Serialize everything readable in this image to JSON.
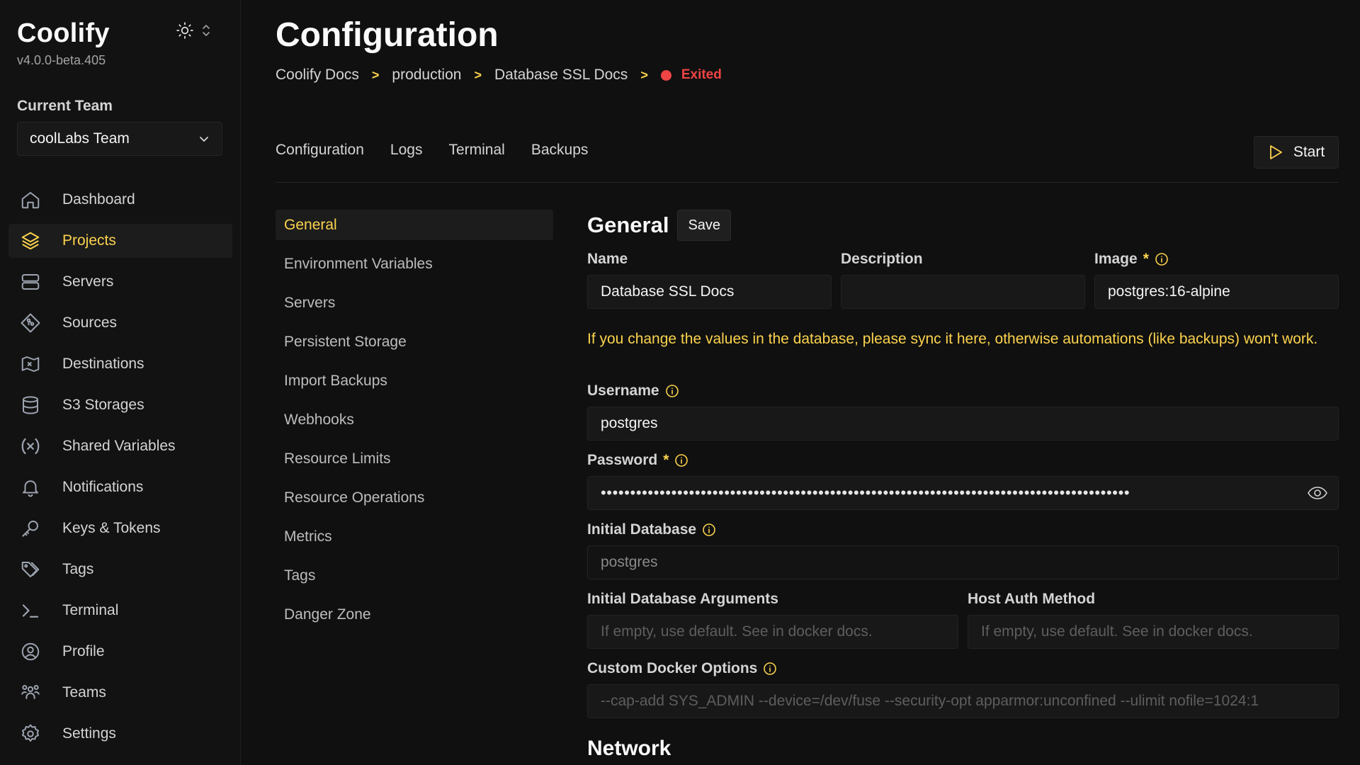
{
  "app": {
    "name": "Coolify",
    "version": "v4.0.0-beta.405"
  },
  "team": {
    "label": "Current Team",
    "selected": "coolLabs Team"
  },
  "sidebar": {
    "items": [
      {
        "label": "Dashboard",
        "icon": "home-icon"
      },
      {
        "label": "Projects",
        "icon": "layers-icon",
        "active": true
      },
      {
        "label": "Servers",
        "icon": "server-icon"
      },
      {
        "label": "Sources",
        "icon": "git-icon"
      },
      {
        "label": "Destinations",
        "icon": "destination-icon"
      },
      {
        "label": "S3 Storages",
        "icon": "database-icon"
      },
      {
        "label": "Shared Variables",
        "icon": "variable-icon"
      },
      {
        "label": "Notifications",
        "icon": "bell-icon"
      },
      {
        "label": "Keys & Tokens",
        "icon": "key-icon"
      },
      {
        "label": "Tags",
        "icon": "tag-icon"
      },
      {
        "label": "Terminal",
        "icon": "terminal-icon"
      },
      {
        "label": "Profile",
        "icon": "user-circle-icon"
      },
      {
        "label": "Teams",
        "icon": "users-icon"
      },
      {
        "label": "Settings",
        "icon": "gear-icon"
      }
    ]
  },
  "page": {
    "title": "Configuration",
    "breadcrumb": [
      "Coolify Docs",
      "production",
      "Database SSL Docs"
    ],
    "status": "Exited"
  },
  "tabs": [
    "Configuration",
    "Logs",
    "Terminal",
    "Backups"
  ],
  "start_label": "Start",
  "subnav": [
    "General",
    "Environment Variables",
    "Servers",
    "Persistent Storage",
    "Import Backups",
    "Webhooks",
    "Resource Limits",
    "Resource Operations",
    "Metrics",
    "Tags",
    "Danger Zone"
  ],
  "general": {
    "title": "General",
    "save_label": "Save",
    "name_label": "Name",
    "name_value": "Database SSL Docs",
    "description_label": "Description",
    "description_value": "",
    "image_label": "Image",
    "image_value": "postgres:16-alpine",
    "warning": "If you change the values in the database, please sync it here, otherwise automations (like backups) won't work.",
    "username_label": "Username",
    "username_value": "postgres",
    "password_label": "Password",
    "password_masked": "••••••••••••••••••••••••••••••••••••••••••••••••••••••••••••••••••••••••••••••••••••••••••",
    "initial_db_label": "Initial Database",
    "initial_db_value": "postgres",
    "init_args_label": "Initial Database Arguments",
    "init_args_placeholder": "If empty, use default. See in docker docs.",
    "host_auth_label": "Host Auth Method",
    "host_auth_placeholder": "If empty, use default. See in docker docs.",
    "docker_opts_label": "Custom Docker Options",
    "docker_opts_placeholder": "--cap-add SYS_ADMIN --device=/dev/fuse --security-opt apparmor:unconfined --ulimit nofile=1024:1",
    "network_title": "Network"
  },
  "colors": {
    "accent": "#fcd34d",
    "danger": "#ef4444",
    "background": "#101010"
  }
}
